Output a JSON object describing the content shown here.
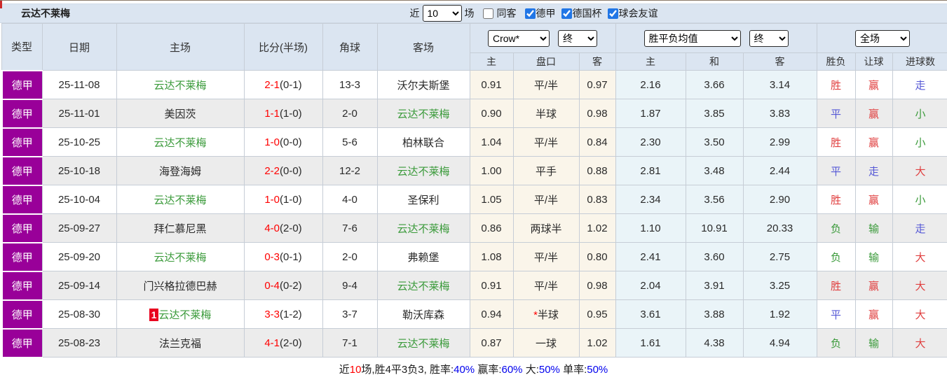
{
  "colors": {
    "league_purple": "#990099",
    "header_bg": "#dbe5f1",
    "row_alt_bg": "#ececec",
    "handicap_odds_bg": "#faf5ea",
    "average_odds_bg": "#eaf4f8",
    "team_green": "#3a9a3a",
    "score_red": "#ff0000",
    "win_red": "#e03e3e",
    "draw_blue": "#5558d6",
    "lose_green": "#3a9a3a",
    "badge_red": "#e8001f",
    "checkbox_blue": "#2176e6",
    "summary_blue": "#0000ee"
  },
  "topbar": {
    "team_title": "云达不莱梅",
    "recent_label": "近",
    "recent_value": "10",
    "games_label": "场",
    "same_away_label": "同客",
    "same_away_checked": false,
    "leagues": [
      {
        "label": "德甲",
        "checked": true
      },
      {
        "label": "德国杯",
        "checked": true
      },
      {
        "label": "球会友谊",
        "checked": true
      }
    ]
  },
  "table": {
    "columns": [
      "类型",
      "日期",
      "主场",
      "比分(半场)",
      "角球",
      "客场"
    ],
    "selects": {
      "company": "Crow*",
      "company_time": "终",
      "average": "胜平负均值",
      "average_time": "终",
      "scope": "全场"
    },
    "sub_headers": [
      "主",
      "盘口",
      "客",
      "主",
      "和",
      "客",
      "胜负",
      "让球",
      "进球数"
    ],
    "rows": [
      {
        "league": "德甲",
        "date": "25-11-08",
        "badge": "",
        "home": "云达不莱梅",
        "home_is_team": true,
        "score": "2-1",
        "half": "(0-1)",
        "corners": "13-3",
        "away": "沃尔夫斯堡",
        "away_is_team": false,
        "odds_home": "0.91",
        "handicap_prefix": "",
        "handicap": "平/半",
        "odds_away": "0.97",
        "avg_home": "2.16",
        "avg_draw": "3.66",
        "avg_away": "3.14",
        "result": "胜",
        "result_color": "red",
        "handicap_result": "赢",
        "hresult_color": "red",
        "goals": "走",
        "goals_color": "blue"
      },
      {
        "league": "德甲",
        "date": "25-11-01",
        "badge": "",
        "home": "美因茨",
        "home_is_team": false,
        "score": "1-1",
        "half": "(1-0)",
        "corners": "2-0",
        "away": "云达不莱梅",
        "away_is_team": true,
        "odds_home": "0.90",
        "handicap_prefix": "",
        "handicap": "半球",
        "odds_away": "0.98",
        "avg_home": "1.87",
        "avg_draw": "3.85",
        "avg_away": "3.83",
        "result": "平",
        "result_color": "blue",
        "handicap_result": "赢",
        "hresult_color": "red",
        "goals": "小",
        "goals_color": "green"
      },
      {
        "league": "德甲",
        "date": "25-10-25",
        "badge": "",
        "home": "云达不莱梅",
        "home_is_team": true,
        "score": "1-0",
        "half": "(0-0)",
        "corners": "5-6",
        "away": "柏林联合",
        "away_is_team": false,
        "odds_home": "1.04",
        "handicap_prefix": "",
        "handicap": "平/半",
        "odds_away": "0.84",
        "avg_home": "2.30",
        "avg_draw": "3.50",
        "avg_away": "2.99",
        "result": "胜",
        "result_color": "red",
        "handicap_result": "赢",
        "hresult_color": "red",
        "goals": "小",
        "goals_color": "green"
      },
      {
        "league": "德甲",
        "date": "25-10-18",
        "badge": "",
        "home": "海登海姆",
        "home_is_team": false,
        "score": "2-2",
        "half": "(0-0)",
        "corners": "12-2",
        "away": "云达不莱梅",
        "away_is_team": true,
        "odds_home": "1.00",
        "handicap_prefix": "",
        "handicap": "平手",
        "odds_away": "0.88",
        "avg_home": "2.81",
        "avg_draw": "3.48",
        "avg_away": "2.44",
        "result": "平",
        "result_color": "blue",
        "handicap_result": "走",
        "hresult_color": "blue",
        "goals": "大",
        "goals_color": "red"
      },
      {
        "league": "德甲",
        "date": "25-10-04",
        "badge": "",
        "home": "云达不莱梅",
        "home_is_team": true,
        "score": "1-0",
        "half": "(1-0)",
        "corners": "4-0",
        "away": "圣保利",
        "away_is_team": false,
        "odds_home": "1.05",
        "handicap_prefix": "",
        "handicap": "平/半",
        "odds_away": "0.83",
        "avg_home": "2.34",
        "avg_draw": "3.56",
        "avg_away": "2.90",
        "result": "胜",
        "result_color": "red",
        "handicap_result": "赢",
        "hresult_color": "red",
        "goals": "小",
        "goals_color": "green"
      },
      {
        "league": "德甲",
        "date": "25-09-27",
        "badge": "",
        "home": "拜仁慕尼黑",
        "home_is_team": false,
        "score": "4-0",
        "half": "(2-0)",
        "corners": "7-6",
        "away": "云达不莱梅",
        "away_is_team": true,
        "odds_home": "0.86",
        "handicap_prefix": "",
        "handicap": "两球半",
        "odds_away": "1.02",
        "avg_home": "1.10",
        "avg_draw": "10.91",
        "avg_away": "20.33",
        "result": "负",
        "result_color": "green",
        "handicap_result": "输",
        "hresult_color": "green",
        "goals": "走",
        "goals_color": "blue"
      },
      {
        "league": "德甲",
        "date": "25-09-20",
        "badge": "",
        "home": "云达不莱梅",
        "home_is_team": true,
        "score": "0-3",
        "half": "(0-1)",
        "corners": "2-0",
        "away": "弗赖堡",
        "away_is_team": false,
        "odds_home": "1.08",
        "handicap_prefix": "",
        "handicap": "平/半",
        "odds_away": "0.80",
        "avg_home": "2.41",
        "avg_draw": "3.60",
        "avg_away": "2.75",
        "result": "负",
        "result_color": "green",
        "handicap_result": "输",
        "hresult_color": "green",
        "goals": "大",
        "goals_color": "red"
      },
      {
        "league": "德甲",
        "date": "25-09-14",
        "badge": "",
        "home": "门兴格拉德巴赫",
        "home_is_team": false,
        "score": "0-4",
        "half": "(0-2)",
        "corners": "9-4",
        "away": "云达不莱梅",
        "away_is_team": true,
        "odds_home": "0.91",
        "handicap_prefix": "",
        "handicap": "平/半",
        "odds_away": "0.98",
        "avg_home": "2.04",
        "avg_draw": "3.91",
        "avg_away": "3.25",
        "result": "胜",
        "result_color": "red",
        "handicap_result": "赢",
        "hresult_color": "red",
        "goals": "大",
        "goals_color": "red"
      },
      {
        "league": "德甲",
        "date": "25-08-30",
        "badge": "1",
        "home": "云达不莱梅",
        "home_is_team": true,
        "score": "3-3",
        "half": "(1-2)",
        "corners": "3-7",
        "away": "勒沃库森",
        "away_is_team": false,
        "odds_home": "0.94",
        "handicap_prefix": "*",
        "handicap": "半球",
        "odds_away": "0.95",
        "avg_home": "3.61",
        "avg_draw": "3.88",
        "avg_away": "1.92",
        "result": "平",
        "result_color": "blue",
        "handicap_result": "赢",
        "hresult_color": "red",
        "goals": "大",
        "goals_color": "red"
      },
      {
        "league": "德甲",
        "date": "25-08-23",
        "badge": "",
        "home": "法兰克福",
        "home_is_team": false,
        "score": "4-1",
        "half": "(2-0)",
        "corners": "7-1",
        "away": "云达不莱梅",
        "away_is_team": true,
        "odds_home": "0.87",
        "handicap_prefix": "",
        "handicap": "一球",
        "odds_away": "1.02",
        "avg_home": "1.61",
        "avg_draw": "4.38",
        "avg_away": "4.94",
        "result": "负",
        "result_color": "green",
        "handicap_result": "输",
        "hresult_color": "green",
        "goals": "大",
        "goals_color": "red"
      }
    ]
  },
  "summary": {
    "segments": [
      {
        "text": "近",
        "color": "black"
      },
      {
        "text": "10",
        "color": "red"
      },
      {
        "text": "场,胜4平3负3, 胜率:",
        "color": "black"
      },
      {
        "text": "40%",
        "color": "blue"
      },
      {
        "text": " 赢率:",
        "color": "black"
      },
      {
        "text": "60%",
        "color": "blue"
      },
      {
        "text": " 大:",
        "color": "black"
      },
      {
        "text": "50%",
        "color": "blue"
      },
      {
        "text": " 单率:",
        "color": "black"
      },
      {
        "text": "50%",
        "color": "blue"
      }
    ]
  }
}
